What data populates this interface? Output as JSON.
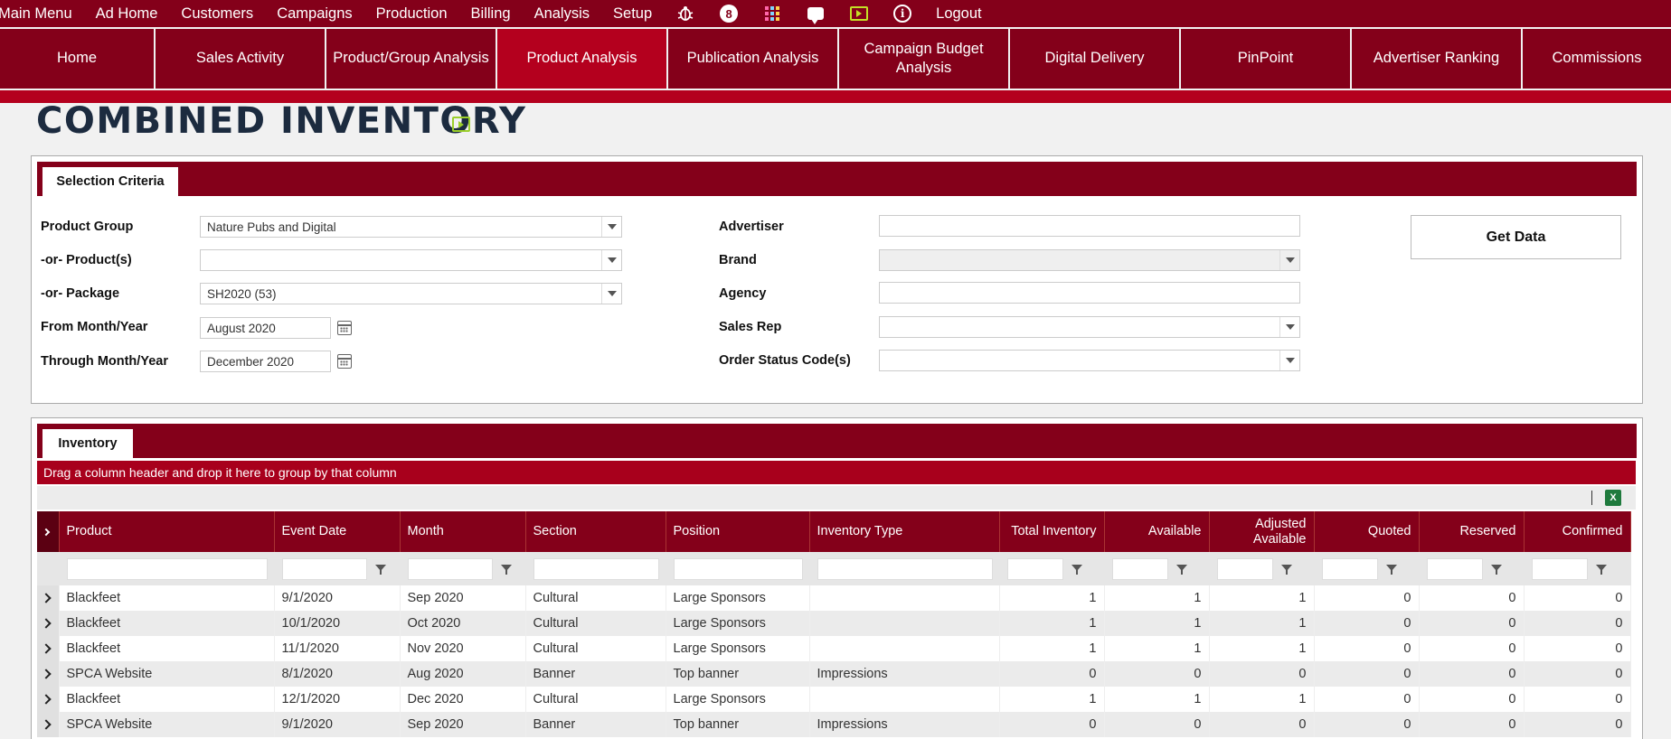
{
  "topmenu": {
    "items": [
      "Main Menu",
      "Ad Home",
      "Customers",
      "Campaigns",
      "Production",
      "Billing",
      "Analysis",
      "Setup"
    ],
    "notification_count": "8",
    "info_glyph": "i",
    "logout": "Logout",
    "icons": [
      "bug-icon",
      "notification-icon",
      "apps-grid-icon",
      "chat-icon",
      "video-icon",
      "info-icon"
    ]
  },
  "nav": {
    "tabs": [
      "Home",
      "Sales Activity",
      "Product/Group Analysis",
      "Product Analysis",
      "Publication Analysis",
      "Campaign Budget Analysis",
      "Digital Delivery",
      "PinPoint",
      "Advertiser Ranking",
      "Commissions"
    ],
    "active": "Product Analysis"
  },
  "page": {
    "title": "COMBINED INVENTORY"
  },
  "criteria": {
    "tab_label": "Selection Criteria",
    "product_group_label": "Product Group",
    "product_group_value": "Nature Pubs and Digital",
    "products_label": "-or- Product(s)",
    "products_value": "",
    "package_label": "-or- Package",
    "package_value": "SH2020 (53)",
    "from_label": "From Month/Year",
    "from_value": "August 2020",
    "through_label": "Through Month/Year",
    "through_value": "December 2020",
    "advertiser_label": "Advertiser",
    "brand_label": "Brand",
    "agency_label": "Agency",
    "salesrep_label": "Sales Rep",
    "status_label": "Order Status Code(s)",
    "get_data": "Get Data"
  },
  "inventory": {
    "tab_label": "Inventory",
    "group_hint": "Drag a column header and drop it here to group by that column",
    "excel_glyph": "X",
    "columns": [
      "Product",
      "Event Date",
      "Month",
      "Section",
      "Position",
      "Inventory Type",
      "Total Inventory",
      "Available",
      "Adjusted Available",
      "Quoted",
      "Reserved",
      "Confirmed"
    ],
    "rows": [
      [
        "Blackfeet",
        "9/1/2020",
        "Sep 2020",
        "Cultural",
        "Large Sponsors",
        "",
        "1",
        "1",
        "1",
        "0",
        "0",
        "0"
      ],
      [
        "Blackfeet",
        "10/1/2020",
        "Oct 2020",
        "Cultural",
        "Large Sponsors",
        "",
        "1",
        "1",
        "1",
        "0",
        "0",
        "0"
      ],
      [
        "Blackfeet",
        "11/1/2020",
        "Nov 2020",
        "Cultural",
        "Large Sponsors",
        "",
        "1",
        "1",
        "1",
        "0",
        "0",
        "0"
      ],
      [
        "SPCA Website",
        "8/1/2020",
        "Aug 2020",
        "Banner",
        "Top banner",
        "Impressions",
        "0",
        "0",
        "0",
        "0",
        "0",
        "0"
      ],
      [
        "Blackfeet",
        "12/1/2020",
        "Dec 2020",
        "Cultural",
        "Large Sponsors",
        "",
        "1",
        "1",
        "1",
        "0",
        "0",
        "0"
      ],
      [
        "SPCA Website",
        "9/1/2020",
        "Sep 2020",
        "Banner",
        "Top banner",
        "Impressions",
        "0",
        "0",
        "0",
        "0",
        "0",
        "0"
      ]
    ]
  }
}
